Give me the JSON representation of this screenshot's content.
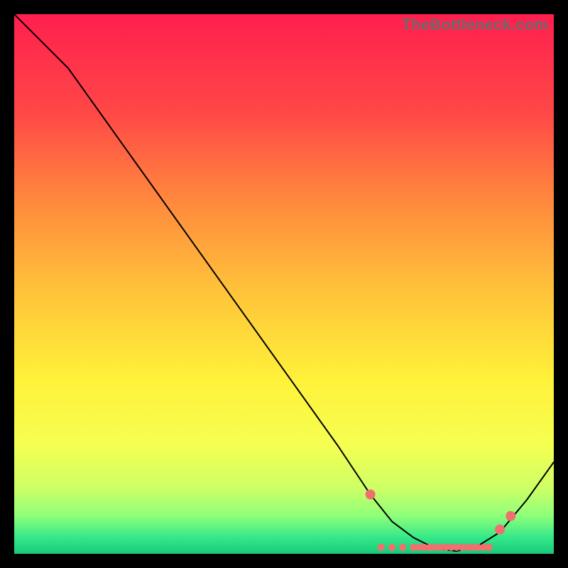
{
  "watermark": {
    "text": "TheBottleneck.com"
  },
  "chart_data": {
    "type": "line",
    "title": "",
    "xlabel": "",
    "ylabel": "",
    "xlim": [
      0,
      100
    ],
    "ylim": [
      0,
      100
    ],
    "grid": false,
    "legend": false,
    "series": [
      {
        "name": "bottleneck-curve",
        "points": [
          {
            "x": 0,
            "y": 100
          },
          {
            "x": 6,
            "y": 94
          },
          {
            "x": 10,
            "y": 90
          },
          {
            "x": 20,
            "y": 76
          },
          {
            "x": 30,
            "y": 62
          },
          {
            "x": 40,
            "y": 48
          },
          {
            "x": 50,
            "y": 34
          },
          {
            "x": 60,
            "y": 20
          },
          {
            "x": 66,
            "y": 11
          },
          {
            "x": 70,
            "y": 6
          },
          {
            "x": 74,
            "y": 3
          },
          {
            "x": 78,
            "y": 1
          },
          {
            "x": 82,
            "y": 0.5
          },
          {
            "x": 86,
            "y": 1.5
          },
          {
            "x": 90,
            "y": 4
          },
          {
            "x": 95,
            "y": 10
          },
          {
            "x": 100,
            "y": 17
          }
        ]
      }
    ],
    "markers": {
      "name": "optimal-range-points",
      "large": [
        {
          "x": 66,
          "y": 11
        },
        {
          "x": 90,
          "y": 4.5
        },
        {
          "x": 92,
          "y": 7
        }
      ],
      "small_band_x": [
        68,
        70,
        72,
        74,
        75,
        76,
        77,
        78,
        79,
        80,
        81,
        82,
        83,
        84,
        85,
        86,
        87,
        88
      ],
      "small_band_y": 1.2
    },
    "background_gradient": {
      "stops": [
        {
          "offset": 0.0,
          "color": "#ff1f4e"
        },
        {
          "offset": 0.18,
          "color": "#ff4747"
        },
        {
          "offset": 0.35,
          "color": "#ff8a3d"
        },
        {
          "offset": 0.52,
          "color": "#ffc53a"
        },
        {
          "offset": 0.68,
          "color": "#fff23a"
        },
        {
          "offset": 0.8,
          "color": "#f5ff52"
        },
        {
          "offset": 0.88,
          "color": "#ccff66"
        },
        {
          "offset": 0.93,
          "color": "#8dff7a"
        },
        {
          "offset": 0.97,
          "color": "#35e889"
        },
        {
          "offset": 1.0,
          "color": "#19c97a"
        }
      ]
    }
  }
}
